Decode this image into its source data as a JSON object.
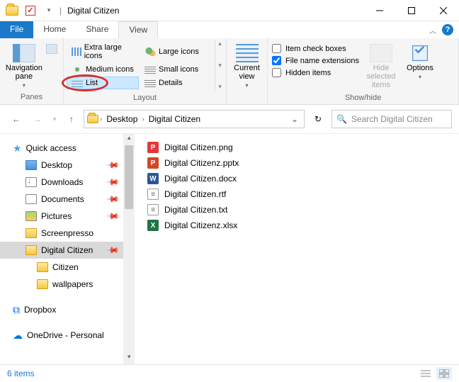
{
  "window": {
    "title": "Digital Citizen"
  },
  "tabs": {
    "file": "File",
    "home": "Home",
    "share": "Share",
    "view": "View",
    "active": "View"
  },
  "ribbon": {
    "panes": {
      "navpane": "Navigation\npane",
      "group": "Panes"
    },
    "layout": {
      "group": "Layout",
      "items": {
        "xlarge": "Extra large icons",
        "large": "Large icons",
        "medium": "Medium icons",
        "small": "Small icons",
        "list": "List",
        "details": "Details"
      },
      "selected": "list"
    },
    "current_view": {
      "label": "Current\nview",
      "group": ""
    },
    "showhide": {
      "group": "Show/hide",
      "item_checkboxes": "Item check boxes",
      "file_ext": "File name extensions",
      "hidden": "Hidden items",
      "file_ext_checked": true,
      "item_checkboxes_checked": false,
      "hidden_checked": false,
      "hide_selected": "Hide selected\nitems"
    },
    "options": "Options"
  },
  "address": {
    "crumbs": [
      "Desktop",
      "Digital Citizen"
    ]
  },
  "search": {
    "placeholder": "Search Digital Citizen"
  },
  "tree": {
    "quick_access": "Quick access",
    "desktop": "Desktop",
    "downloads": "Downloads",
    "documents": "Documents",
    "pictures": "Pictures",
    "screenpresso": "Screenpresso",
    "digital_citizen": "Digital Citizen",
    "citizen": "Citizen",
    "wallpapers": "wallpapers",
    "dropbox": "Dropbox",
    "onedrive": "OneDrive - Personal"
  },
  "files": [
    {
      "name": "Digital Citizen.png",
      "type": "png"
    },
    {
      "name": "Digital Citizenz.pptx",
      "type": "pptx"
    },
    {
      "name": "Digital Citizen.docx",
      "type": "docx"
    },
    {
      "name": "Digital Citizen.rtf",
      "type": "rtf"
    },
    {
      "name": "Digital Citizen.txt",
      "type": "txt"
    },
    {
      "name": "Digital Citizenz.xlsx",
      "type": "xlsx"
    }
  ],
  "status": {
    "count": "6 items"
  }
}
